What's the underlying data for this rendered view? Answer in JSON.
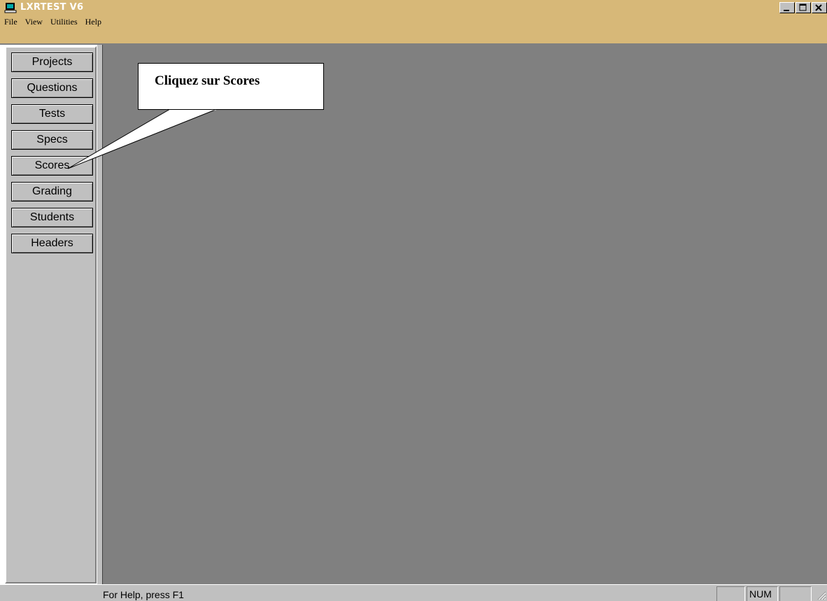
{
  "window": {
    "title": "LXRTEST V6",
    "icon": "computer-icon",
    "controls": [
      "minimize-icon",
      "maximize-icon",
      "close-icon"
    ],
    "title_bar_color": "#d7b878"
  },
  "menu": {
    "items": [
      {
        "label": "File"
      },
      {
        "label": "View"
      },
      {
        "label": "Utilities"
      },
      {
        "label": "Help"
      }
    ]
  },
  "sidebar": {
    "buttons": [
      {
        "label": "Projects"
      },
      {
        "label": "Questions"
      },
      {
        "label": "Tests"
      },
      {
        "label": "Specs"
      },
      {
        "label": "Scores"
      },
      {
        "label": "Grading"
      },
      {
        "label": "Students"
      },
      {
        "label": "Headers"
      }
    ]
  },
  "callout": {
    "text": "Cliquez sur Scores"
  },
  "status": {
    "help_text": "For Help, press F1",
    "num_indicator": "NUM"
  }
}
